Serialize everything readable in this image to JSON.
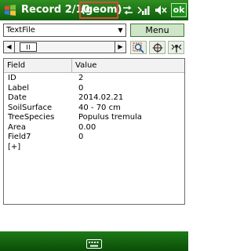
{
  "title_bar": {
    "title": "Record 2/10",
    "geom_label": "(geom)",
    "ok_label": "ok",
    "icons": [
      "windows-flag-icon",
      "connectivity-icon",
      "signal-icon",
      "volume-icon"
    ]
  },
  "toolbar": {
    "layer_select_value": "TextFile",
    "menu_label": "Menu",
    "icons": [
      "zoom-to-feature-icon",
      "locate-gps-icon",
      "gps-record-icon"
    ]
  },
  "grid": {
    "columns": [
      "Field",
      "Value"
    ],
    "rows": [
      {
        "field": "ID",
        "value": "2"
      },
      {
        "field": "Label",
        "value": "0"
      },
      {
        "field": "Date",
        "value": "2014.02.21"
      },
      {
        "field": "SoilSurface",
        "value": "40 - 70 cm"
      },
      {
        "field": "TreeSpecies",
        "value": "Populus tremula"
      },
      {
        "field": "Area",
        "value": "0.00"
      },
      {
        "field": "Field7",
        "value": "0"
      },
      {
        "field": "[+]",
        "value": ""
      }
    ]
  },
  "bottom_bar": {
    "icon": "keyboard-icon"
  },
  "colors": {
    "title_bar_green": "#1e7a18",
    "geom_highlight_border": "#e0453a",
    "menu_button_bg": "#cfe5c8"
  }
}
